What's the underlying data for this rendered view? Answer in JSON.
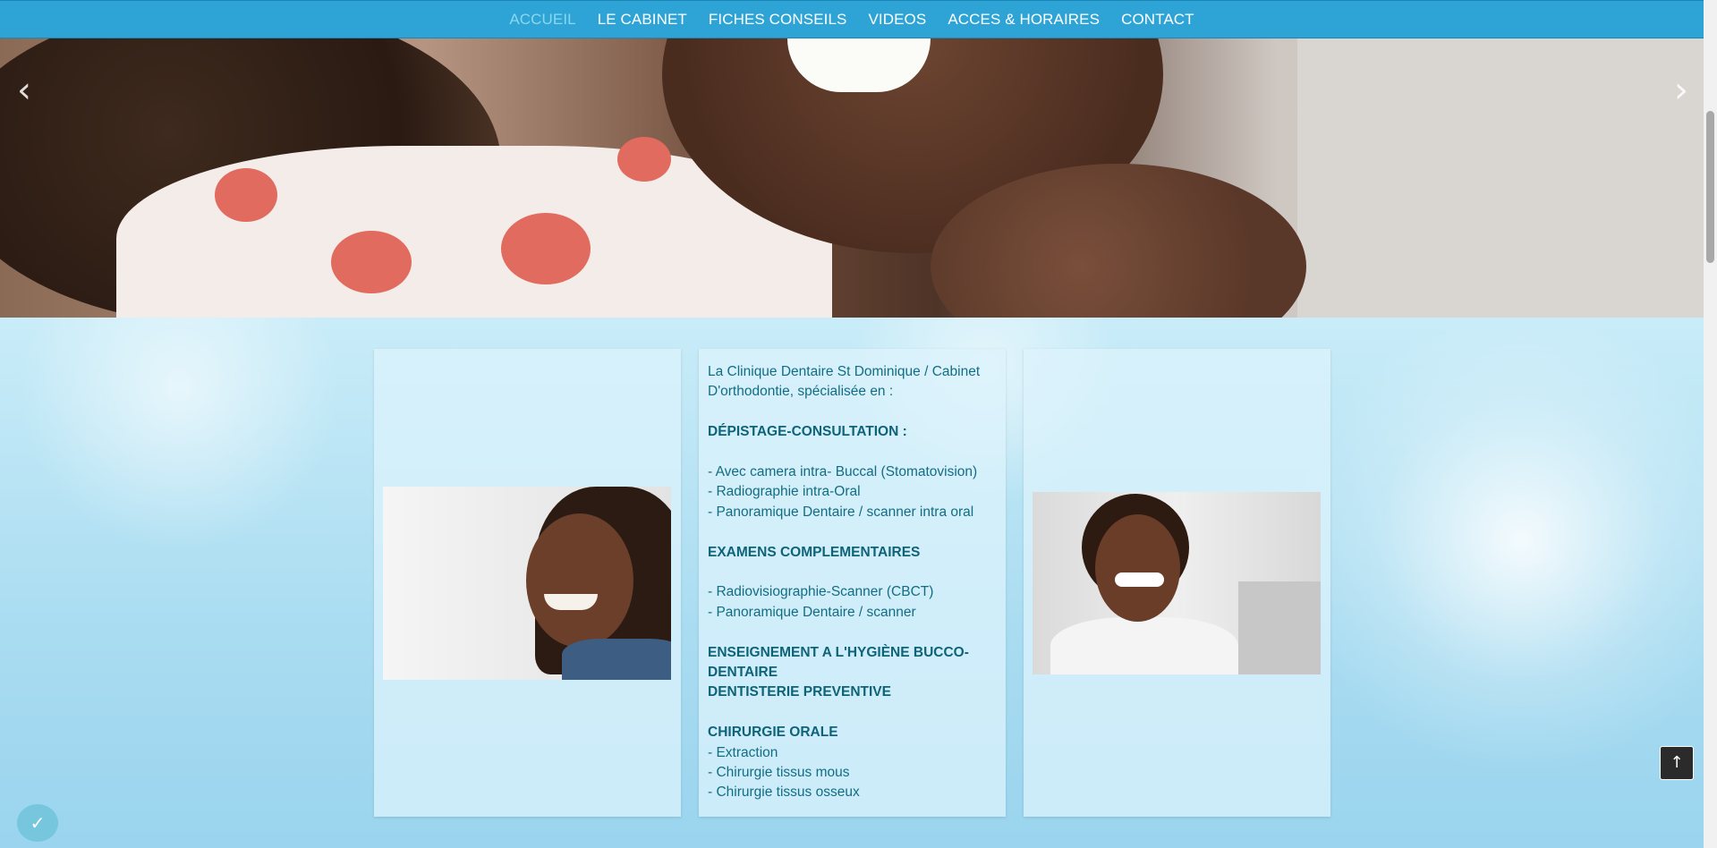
{
  "nav": {
    "items": [
      {
        "label": "ACCUEIL",
        "active": true
      },
      {
        "label": "LE CABINET",
        "active": false
      },
      {
        "label": "FICHES CONSEILS",
        "active": false
      },
      {
        "label": "VIDEOS",
        "active": false
      },
      {
        "label": "ACCES & HORAIRES",
        "active": false
      },
      {
        "label": "CONTACT",
        "active": false
      }
    ],
    "background_color": "#2ea3d6",
    "active_color": "#8ad8f0"
  },
  "slider": {
    "prev_icon": "chevron-left-icon",
    "next_icon": "chevron-right-icon",
    "slide_count": 2,
    "active_slide": 2
  },
  "services": {
    "intro": "La Clinique Dentaire St Dominique / Cabinet D'orthodontie, spécialisée en :",
    "depistage": {
      "heading": "DÉPISTAGE-CONSULTATION :",
      "items": [
        "- Avec camera intra- Buccal (Stomatovision)",
        "- Radiographie intra-Oral",
        "- Panoramique Dentaire / scanner intra oral"
      ]
    },
    "examens": {
      "heading": "EXAMENS COMPLEMENTAIRES",
      "items": [
        "- Radiovisiographie-Scanner (CBCT)",
        "- Panoramique Dentaire / scanner"
      ]
    },
    "enseignement": {
      "heading": "ENSEIGNEMENT A L'HYGIÈNE BUCCO-DENTAIRE",
      "heading2": "DENTISTERIE PREVENTIVE"
    },
    "chirurgie": {
      "heading": "CHIRURGIE ORALE",
      "items": [
        "- Extraction",
        "- Chirurgie tissus mous",
        "- Chirurgie tissus osseux"
      ]
    }
  },
  "floating": {
    "scroll_top_icon": "arrow-up-icon",
    "badge_icon": "checkmark-badge-icon"
  }
}
